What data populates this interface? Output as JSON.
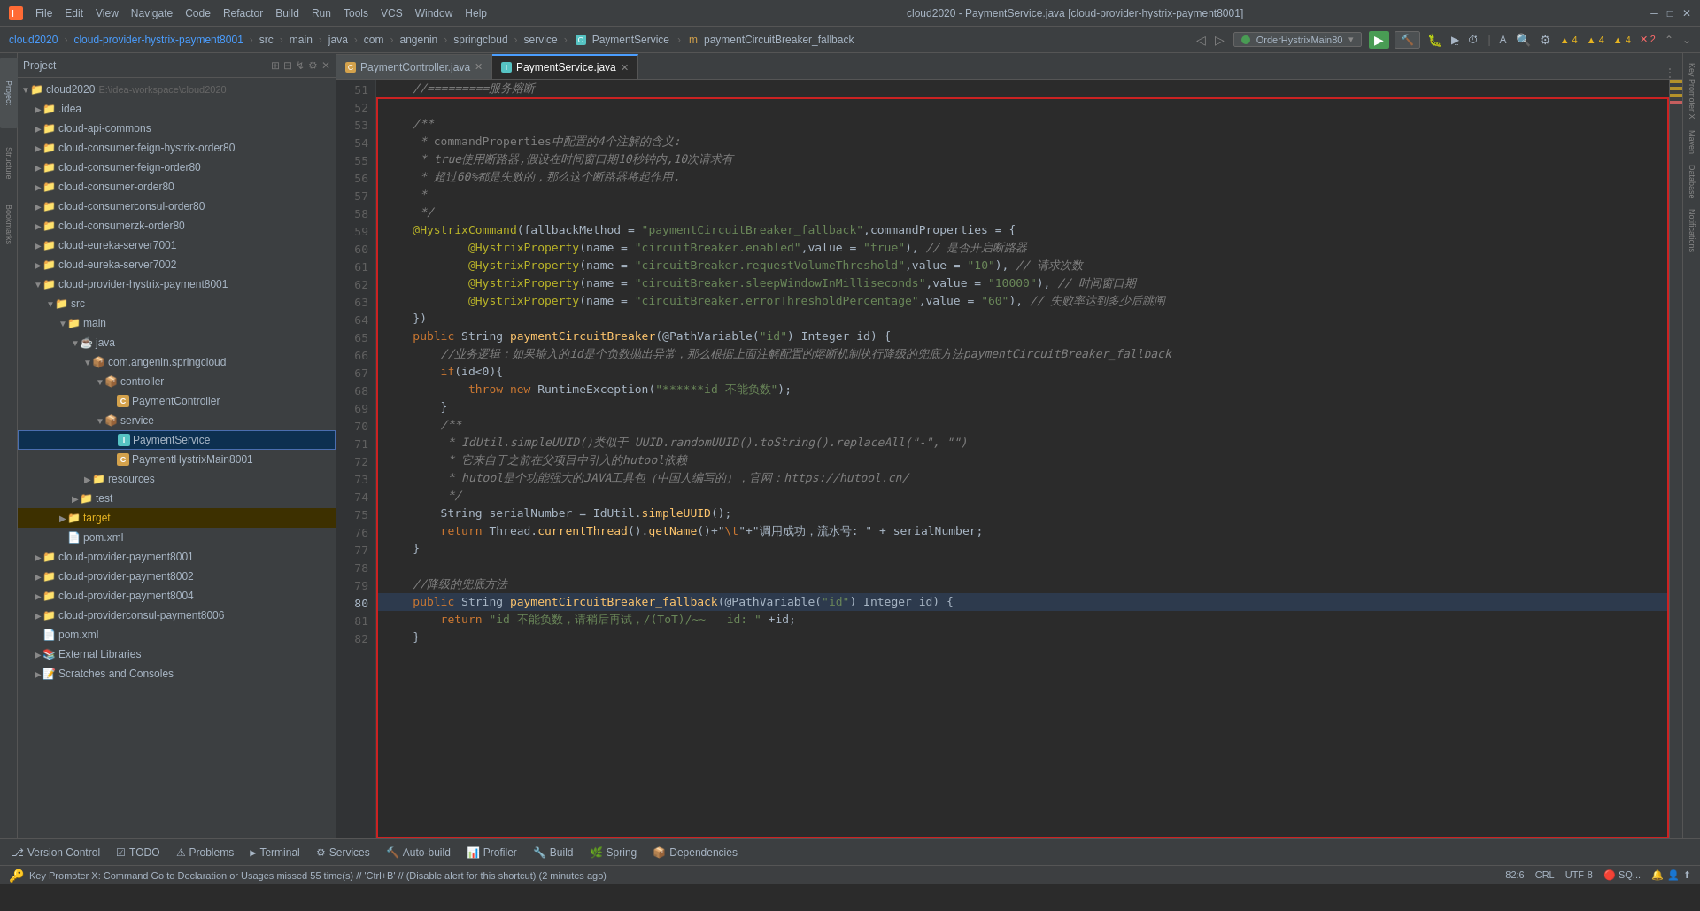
{
  "app": {
    "title": "cloud2020 - PaymentService.java [cloud-provider-hystrix-payment8001]",
    "icon": "idea-icon"
  },
  "titlebar": {
    "menus": [
      "File",
      "Edit",
      "View",
      "Navigate",
      "Code",
      "Refactor",
      "Build",
      "Run",
      "Tools",
      "VCS",
      "Window",
      "Help"
    ],
    "win_min": "─",
    "win_max": "□",
    "win_close": "✕"
  },
  "breadcrumb": {
    "project": "cloud2020",
    "sep1": "›",
    "module": "cloud-provider-hystrix-payment8001",
    "sep2": "›",
    "src": "src",
    "sep3": "›",
    "main": "main",
    "sep4": "›",
    "java": "java",
    "sep5": "›",
    "com": "com",
    "sep6": "›",
    "angenin": "angenin",
    "sep7": "›",
    "springcloud": "springcloud",
    "sep8": "›",
    "service": "service",
    "sep9": "›",
    "class": "PaymentService",
    "sep10": "›",
    "method": "paymentCircuitBreaker_fallback",
    "run_config": "OrderHystrixMain80"
  },
  "tabs": [
    {
      "id": "tab1",
      "label": "PaymentController.java",
      "icon": "orange",
      "active": false
    },
    {
      "id": "tab2",
      "label": "PaymentService.java",
      "icon": "cyan",
      "active": true
    }
  ],
  "project": {
    "title": "Project",
    "root": "cloud2020",
    "root_path": "E:\\idea-workspace\\cloud2020",
    "items": [
      {
        "label": ".idea",
        "level": 1,
        "type": "folder",
        "expanded": false
      },
      {
        "label": "cloud-api-commons",
        "level": 1,
        "type": "folder",
        "expanded": false
      },
      {
        "label": "cloud-consumer-feign-hystrix-order80",
        "level": 1,
        "type": "folder",
        "expanded": false
      },
      {
        "label": "cloud-consumer-feign-order80",
        "level": 1,
        "type": "folder",
        "expanded": false
      },
      {
        "label": "cloud-consumer-order80",
        "level": 1,
        "type": "folder",
        "expanded": false
      },
      {
        "label": "cloud-consumerconsul-order80",
        "level": 1,
        "type": "folder",
        "expanded": false
      },
      {
        "label": "cloud-consumerzk-order80",
        "level": 1,
        "type": "folder",
        "expanded": false
      },
      {
        "label": "cloud-eureka-server7001",
        "level": 1,
        "type": "folder",
        "expanded": false
      },
      {
        "label": "cloud-eureka-server7002",
        "level": 1,
        "type": "folder",
        "expanded": false
      },
      {
        "label": "cloud-provider-hystrix-payment8001",
        "level": 1,
        "type": "folder",
        "expanded": true
      },
      {
        "label": "src",
        "level": 2,
        "type": "folder",
        "expanded": true
      },
      {
        "label": "main",
        "level": 3,
        "type": "folder",
        "expanded": true
      },
      {
        "label": "java",
        "level": 4,
        "type": "folder",
        "expanded": true
      },
      {
        "label": "com.angenin.springcloud",
        "level": 5,
        "type": "package",
        "expanded": true
      },
      {
        "label": "controller",
        "level": 6,
        "type": "folder",
        "expanded": true
      },
      {
        "label": "PaymentController",
        "level": 7,
        "type": "class-orange",
        "expanded": false
      },
      {
        "label": "service",
        "level": 6,
        "type": "folder",
        "expanded": true
      },
      {
        "label": "PaymentService",
        "level": 7,
        "type": "class-cyan",
        "selected": true
      },
      {
        "label": "PaymentHystrixMain8001",
        "level": 7,
        "type": "class-orange",
        "expanded": false
      },
      {
        "label": "resources",
        "level": 4,
        "type": "folder",
        "expanded": false
      },
      {
        "label": "test",
        "level": 3,
        "type": "folder",
        "expanded": false
      },
      {
        "label": "target",
        "level": 2,
        "type": "folder",
        "expanded": false,
        "highlight": true
      },
      {
        "label": "pom.xml",
        "level": 2,
        "type": "xml"
      },
      {
        "label": "cloud-provider-payment8001",
        "level": 1,
        "type": "folder",
        "expanded": false
      },
      {
        "label": "cloud-provider-payment8002",
        "level": 1,
        "type": "folder",
        "expanded": false
      },
      {
        "label": "cloud-provider-payment8004",
        "level": 1,
        "type": "folder",
        "expanded": false
      },
      {
        "label": "cloud-providerconsul-payment8006",
        "level": 1,
        "type": "folder",
        "expanded": false
      },
      {
        "label": "pom.xml",
        "level": 1,
        "type": "xml"
      },
      {
        "label": "External Libraries",
        "level": 1,
        "type": "library",
        "expanded": false
      },
      {
        "label": "Scratches and Consoles",
        "level": 1,
        "type": "scratch",
        "expanded": false
      }
    ]
  },
  "code": {
    "lines": [
      {
        "num": 51,
        "text": "    //=========服务熔断",
        "type": "comment"
      },
      {
        "num": 52,
        "text": ""
      },
      {
        "num": 53,
        "text": "    /**",
        "type": "comment"
      },
      {
        "num": 54,
        "text": "     * commandProperties中配置的4个注解的含义:",
        "type": "comment"
      },
      {
        "num": 55,
        "text": "     * true使用断路器,假设在时间窗口期10秒钟内,10次请求有",
        "type": "comment"
      },
      {
        "num": 56,
        "text": "     * 超过60%都是失败的，那么这个断路器将起作用.",
        "type": "comment"
      },
      {
        "num": 57,
        "text": "     *",
        "type": "comment"
      },
      {
        "num": 58,
        "text": "     */",
        "type": "comment"
      },
      {
        "num": 59,
        "text": "    @HystrixCommand(fallbackMethod = \"paymentCircuitBreaker_fallback\",commandProperties = {",
        "type": "code"
      },
      {
        "num": 60,
        "text": "            @HystrixProperty(name = \"circuitBreaker.enabled\",value = \"true\"), // 是否开启断路器",
        "type": "code"
      },
      {
        "num": 61,
        "text": "            @HystrixProperty(name = \"circuitBreaker.requestVolumeThreshold\",value = \"10\"), // 请求次数",
        "type": "code"
      },
      {
        "num": 62,
        "text": "            @HystrixProperty(name = \"circuitBreaker.sleepWindowInMilliseconds\",value = \"10000\"), // 时间窗口期",
        "type": "code"
      },
      {
        "num": 63,
        "text": "            @HystrixProperty(name = \"circuitBreaker.errorThresholdPercentage\",value = \"60\"), // 失败率达到多少后跳闸",
        "type": "code"
      },
      {
        "num": 64,
        "text": "    })",
        "type": "code"
      },
      {
        "num": 65,
        "text": "    public String paymentCircuitBreaker(@PathVariable(\"id\") Integer id) {",
        "type": "code"
      },
      {
        "num": 66,
        "text": "        //业务逻辑：如果输入的id是个负数抛出异常，那么根据上面注解配置的熔断机制执行降级的兜底方法paymentCircuitBreaker_fallback",
        "type": "comment"
      },
      {
        "num": 67,
        "text": "        if(id<0){",
        "type": "code"
      },
      {
        "num": 68,
        "text": "            throw new RuntimeException(\"******id 不能负数\");",
        "type": "code"
      },
      {
        "num": 69,
        "text": "        }",
        "type": "code"
      },
      {
        "num": 70,
        "text": "        /**",
        "type": "comment"
      },
      {
        "num": 71,
        "text": "         * IdUtil.simpleUUID()类似于 UUID.randomUUID().toString().replaceAll(\"-\", \"\")",
        "type": "comment"
      },
      {
        "num": 72,
        "text": "         * 它来自于之前在父项目中引入的hutool依赖",
        "type": "comment"
      },
      {
        "num": 73,
        "text": "         * hutool是个功能强大的JAVA工具包（中国人编写的），官网：https://hutool.cn/",
        "type": "comment"
      },
      {
        "num": 74,
        "text": "         */",
        "type": "comment"
      },
      {
        "num": 75,
        "text": "        String serialNumber = IdUtil.simpleUUID();",
        "type": "code"
      },
      {
        "num": 76,
        "text": "        return Thread.currentThread().getName()+\"\\t\"+\"调用成功，流水号: \" + serialNumber;",
        "type": "code"
      },
      {
        "num": 77,
        "text": "    }",
        "type": "code"
      },
      {
        "num": 78,
        "text": ""
      },
      {
        "num": 79,
        "text": "    //降级的兜底方法",
        "type": "comment"
      },
      {
        "num": 80,
        "text": "    public String paymentCircuitBreaker_fallback(@PathVariable(\"id\") Integer id) {",
        "type": "code"
      },
      {
        "num": 81,
        "text": "        return \"id 不能负数，请稍后再试，/(ToT)/~~   id: \" +id;",
        "type": "code"
      },
      {
        "num": 82,
        "text": "    }",
        "type": "code"
      }
    ]
  },
  "bottom_toolbar": {
    "items": [
      {
        "id": "version-control",
        "label": "Version Control",
        "icon": "⎇"
      },
      {
        "id": "todo",
        "label": "TODO",
        "icon": "☑"
      },
      {
        "id": "problems",
        "label": "Problems",
        "icon": "⚠"
      },
      {
        "id": "terminal",
        "label": "Terminal",
        "icon": ">"
      },
      {
        "id": "services",
        "label": "Services",
        "icon": "⚙"
      },
      {
        "id": "auto-build",
        "label": "Auto-build",
        "icon": "🔨"
      },
      {
        "id": "profiler",
        "label": "Profiler",
        "icon": "📊"
      },
      {
        "id": "build",
        "label": "Build",
        "icon": "🔧"
      },
      {
        "id": "spring",
        "label": "Spring",
        "icon": "🌿"
      },
      {
        "id": "dependencies",
        "label": "Dependencies",
        "icon": "📦"
      }
    ]
  },
  "statusbar": {
    "message": "Key Promoter X: Command Go to Declaration or Usages missed 55 time(s) // 'Ctrl+B' // (Disable alert for this shortcut) (2 minutes ago)",
    "position": "82:6",
    "encoding": "CRL",
    "warnings": "▲ 4  ▲ 4  ▲ 4  ✕ 2"
  },
  "right_panels": {
    "items": [
      "Key Promoter X",
      "Maven",
      "Database",
      "Notifications"
    ]
  }
}
